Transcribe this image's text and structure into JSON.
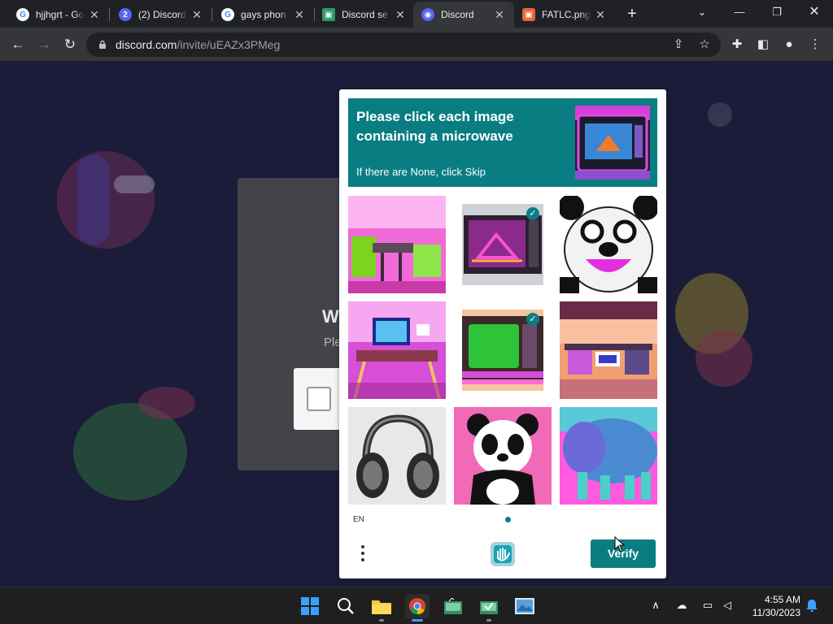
{
  "browser": {
    "tabs": [
      {
        "title": "hjjhgrt - Go",
        "icon": "google-g-icon"
      },
      {
        "title": "(2) Discord",
        "icon": "discord-notification-icon"
      },
      {
        "title": "gays phon",
        "icon": "google-g-icon"
      },
      {
        "title": "Discord se",
        "icon": "image-icon"
      },
      {
        "title": "Discord",
        "icon": "discord-icon"
      },
      {
        "title": "FATLC.png",
        "icon": "image-icon"
      }
    ],
    "active_tab": 4,
    "url_host": "discord.com",
    "url_path": "/invite/uEAZx3PMeg"
  },
  "page": {
    "card_title": "W",
    "card_subtitle": "Ple"
  },
  "captcha": {
    "prompt": "Please click each image containing a microwave",
    "skip_hint": "If there are None, click Skip",
    "tiles": [
      {
        "subject": "pink desk with green monitors",
        "selected": false
      },
      {
        "subject": "neon microwave",
        "selected": true
      },
      {
        "subject": "panda face",
        "selected": false
      },
      {
        "subject": "pink desk with monitor",
        "selected": false
      },
      {
        "subject": "green screen microwave",
        "selected": true
      },
      {
        "subject": "orange desk",
        "selected": false
      },
      {
        "subject": "headphones",
        "selected": false
      },
      {
        "subject": "panda on pink",
        "selected": false
      },
      {
        "subject": "blue furry creature",
        "selected": false
      }
    ],
    "language": "EN",
    "verify_label": "Verify",
    "accent": "#0a7d83"
  },
  "taskbar": {
    "time": "4:55 AM",
    "date": "11/30/2023"
  }
}
